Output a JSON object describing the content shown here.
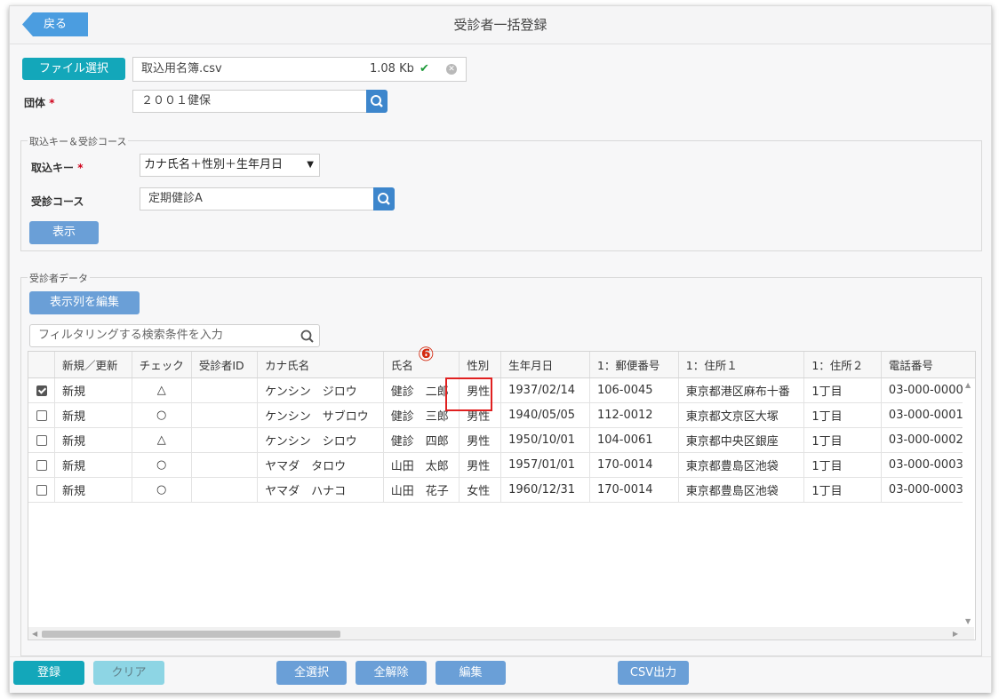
{
  "header": {
    "back_label": "戻る",
    "title": "受診者一括登録"
  },
  "file": {
    "select_label": "ファイル選択",
    "name": "取込用名簿.csv",
    "size": "1.08 Kb"
  },
  "group": {
    "label": "団体",
    "required": "*",
    "value": "２００１健保"
  },
  "import_section": {
    "legend": "取込キー＆受診コース",
    "key_label": "取込キー",
    "key_required": "*",
    "key_value": "カナ氏名＋性別＋生年月日",
    "course_label": "受診コース",
    "course_value": "定期健診A",
    "show_label": "表示"
  },
  "data_section": {
    "legend": "受診者データ",
    "edit_columns_label": "表示列を編集",
    "filter_placeholder": "フィルタリングする検索条件を入力"
  },
  "annotation": {
    "marker": "⑥"
  },
  "table": {
    "columns": [
      "",
      "新規／更新",
      "チェック",
      "受診者ID",
      "カナ氏名",
      "氏名",
      "性別",
      "生年月日",
      "1：郵便番号",
      "1：住所１",
      "1：住所２",
      "電話番号"
    ],
    "rows": [
      {
        "checked": true,
        "type": "新規",
        "check": "△",
        "id": "",
        "kana": "ケンシン　ジロウ",
        "name": "健診　二郎",
        "sex": "男性",
        "dob": "1937/02/14",
        "zip": "106-0045",
        "addr1": "東京都港区麻布十番",
        "addr2": "1丁目",
        "tel": "03-000-0000"
      },
      {
        "checked": false,
        "type": "新規",
        "check": "○",
        "id": "",
        "kana": "ケンシン　サブロウ",
        "name": "健診　三郎",
        "sex": "男性",
        "dob": "1940/05/05",
        "zip": "112-0012",
        "addr1": "東京都文京区大塚",
        "addr2": "1丁目",
        "tel": "03-000-0001"
      },
      {
        "checked": false,
        "type": "新規",
        "check": "△",
        "id": "",
        "kana": "ケンシン　シロウ",
        "name": "健診　四郎",
        "sex": "男性",
        "dob": "1950/10/01",
        "zip": "104-0061",
        "addr1": "東京都中央区銀座",
        "addr2": "1丁目",
        "tel": "03-000-0002"
      },
      {
        "checked": false,
        "type": "新規",
        "check": "○",
        "id": "",
        "kana": "ヤマダ　タロウ",
        "name": "山田　太郎",
        "sex": "男性",
        "dob": "1957/01/01",
        "zip": "170-0014",
        "addr1": "東京都豊島区池袋",
        "addr2": "1丁目",
        "tel": "03-000-0003"
      },
      {
        "checked": false,
        "type": "新規",
        "check": "○",
        "id": "",
        "kana": "ヤマダ　ハナコ",
        "name": "山田　花子",
        "sex": "女性",
        "dob": "1960/12/31",
        "zip": "170-0014",
        "addr1": "東京都豊島区池袋",
        "addr2": "1丁目",
        "tel": "03-000-0003"
      }
    ]
  },
  "footer": {
    "register": "登録",
    "clear": "クリア",
    "select_all": "全選択",
    "deselect_all": "全解除",
    "edit": "編集",
    "csv": "CSV出力"
  },
  "colors": {
    "teal": "#13a7ba",
    "blue": "#6a9fd7",
    "search": "#3d86cc",
    "highlight": "#e02020"
  }
}
